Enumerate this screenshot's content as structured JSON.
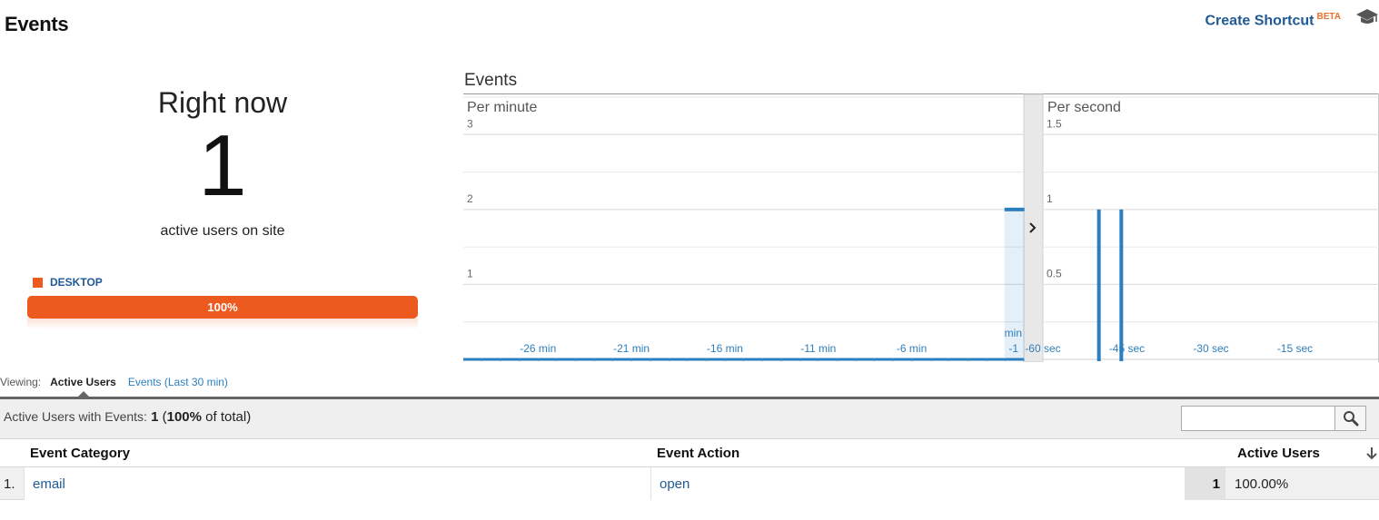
{
  "header": {
    "title": "Events",
    "create_shortcut": "Create Shortcut",
    "beta_badge": "BETA",
    "help_icon": "graduation-cap-icon"
  },
  "right_now": {
    "title": "Right now",
    "count": "1",
    "caption": "active users on site",
    "device_label": "DESKTOP",
    "device_percent_label": "100%",
    "device_share": 1.0,
    "device_color": "#ed5a1f"
  },
  "events_chart": {
    "title": "Events",
    "toggle_icon": "chevron-right-icon",
    "accent_color": "#2c7fbf"
  },
  "chart_data": [
    {
      "type": "bar",
      "title": "Per minute",
      "xlabel": "",
      "ylabel": "",
      "ylim": [
        0,
        3.5
      ],
      "y_ticks": [
        "1",
        "2",
        "3"
      ],
      "x_tick_labels": [
        "-26 min",
        "-21 min",
        "-16 min",
        "-11 min",
        "-6 min",
        "-1 min"
      ],
      "x_range": [
        -30,
        0
      ],
      "bars": [
        {
          "x": -1,
          "value": 2
        }
      ],
      "grid": true
    },
    {
      "type": "bar",
      "title": "Per second",
      "xlabel": "",
      "ylabel": "",
      "ylim": [
        0,
        1.75
      ],
      "y_ticks": [
        "0.5",
        "1",
        "1.5"
      ],
      "x_tick_labels": [
        "-60 sec",
        "-45 sec",
        "-30 sec",
        "-15 sec"
      ],
      "x_range": [
        -60,
        0
      ],
      "bars": [
        {
          "x": -50,
          "value": 1
        },
        {
          "x": -46,
          "value": 1
        }
      ],
      "grid": true
    }
  ],
  "viewing": {
    "label": "Viewing:",
    "tabs": [
      {
        "label": "Active Users",
        "active": true
      },
      {
        "label": "Events (Last 30 min)",
        "active": false
      }
    ]
  },
  "table": {
    "summary_prefix": "Active Users with Events:",
    "summary_count": "1",
    "summary_open": "(",
    "summary_pct": "100%",
    "summary_suffix": "of total)",
    "search_value": "",
    "search_icon": "search-icon",
    "sort_icon": "arrow-down-icon",
    "columns": [
      "Event Category",
      "Event Action",
      "Active Users"
    ],
    "rows": [
      {
        "index": "1.",
        "category": "email",
        "action": "open",
        "active_users": "1",
        "percent": "100.00%"
      }
    ]
  }
}
